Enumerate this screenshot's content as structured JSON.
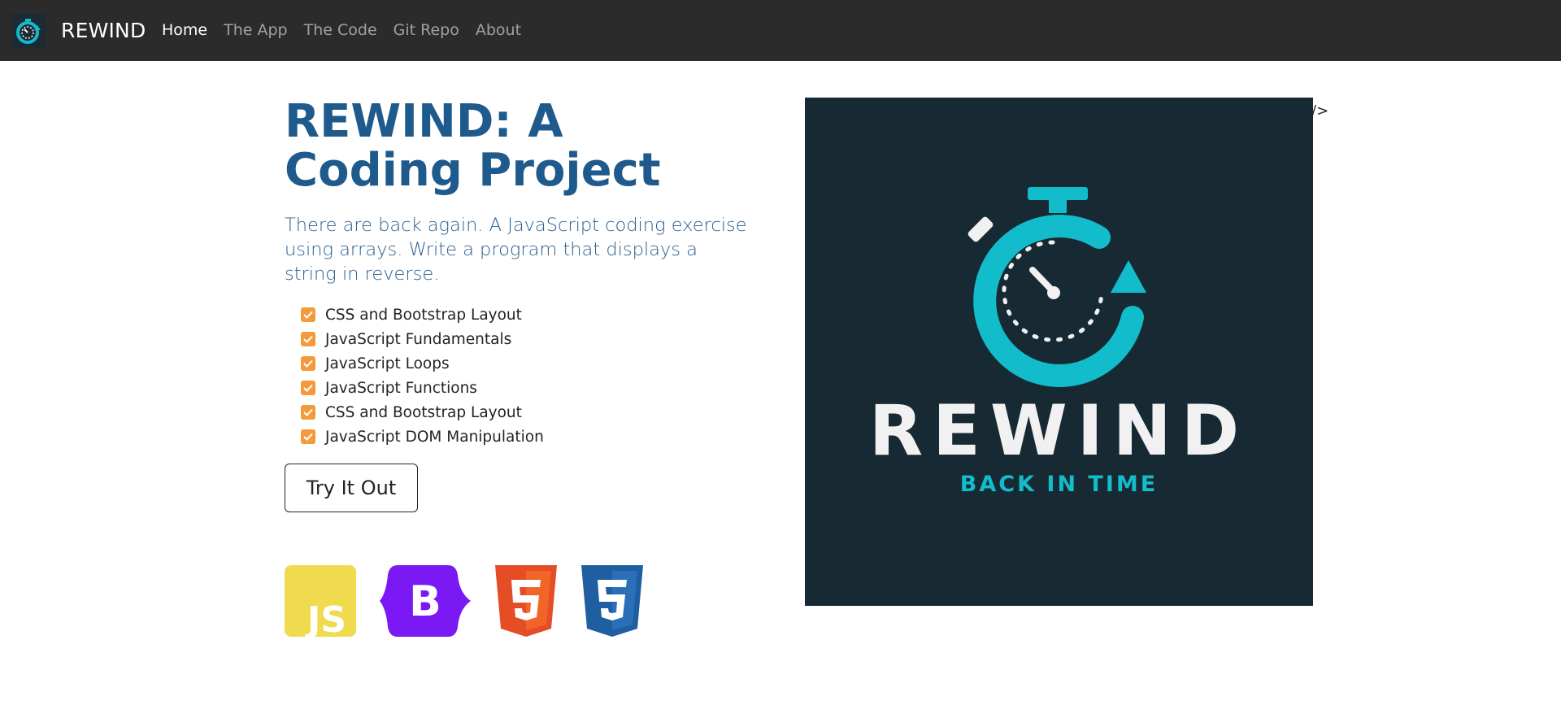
{
  "nav": {
    "brand": "REWIND",
    "links": [
      {
        "label": "Home",
        "active": true
      },
      {
        "label": "The App",
        "active": false
      },
      {
        "label": "The Code",
        "active": false
      },
      {
        "label": "Git Repo",
        "active": false
      },
      {
        "label": "About",
        "active": false
      }
    ]
  },
  "hero": {
    "title": "REWIND: A Coding Project",
    "lead": "There are back again. A JavaScript coding exercise using arrays. Write a program that displays a string in reverse.",
    "features": [
      "CSS and Bootstrap Layout",
      "JavaScript Fundamentals",
      "JavaScript Loops",
      "JavaScript Functions",
      "CSS and Bootstrap Layout",
      "JavaScript DOM Manipulation"
    ],
    "cta_label": "Try It Out",
    "tech_icons": [
      "javascript-icon",
      "bootstrap-icon",
      "html5-icon",
      "css3-icon"
    ],
    "js_label": "JS",
    "bootstrap_label": "B"
  },
  "image": {
    "title": "REWIND",
    "subtitle": "BACK IN TIME",
    "alt_fragment": "/>"
  },
  "colors": {
    "navbar": "#2b2b2b",
    "title_blue": "#1e5a8c",
    "check_orange": "#f39a3c",
    "image_bg": "#172932",
    "teal": "#12bccb"
  }
}
